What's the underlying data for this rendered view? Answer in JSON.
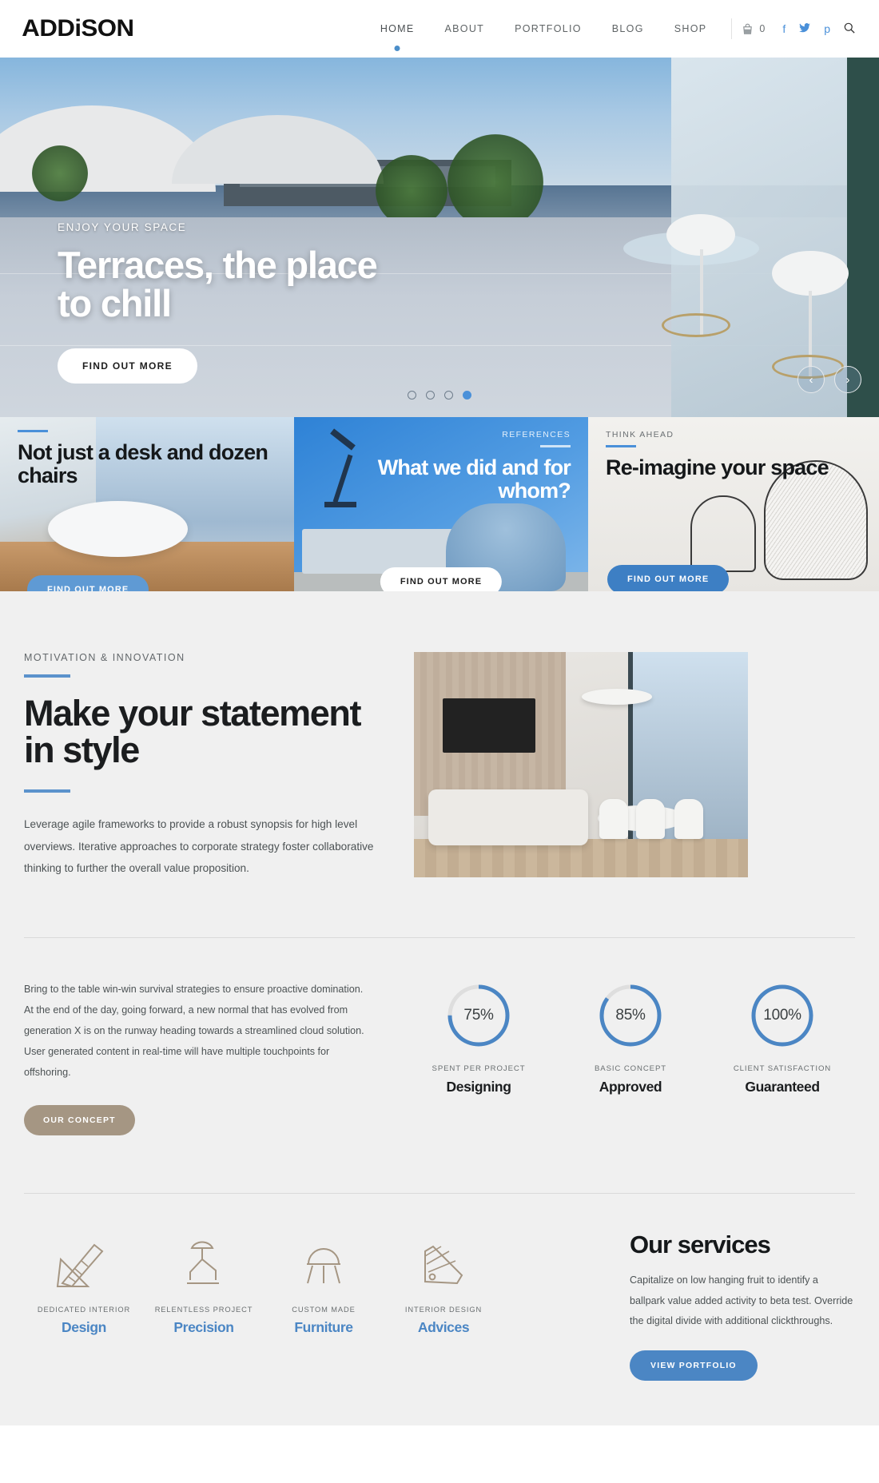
{
  "header": {
    "logo": "ADDiSON",
    "nav": [
      {
        "label": "HOME",
        "active": true
      },
      {
        "label": "ABOUT",
        "active": false
      },
      {
        "label": "PORTFOLIO",
        "active": false
      },
      {
        "label": "BLOG",
        "active": false
      },
      {
        "label": "SHOP",
        "active": false
      }
    ],
    "cart_count": "0",
    "socials": [
      "facebook-icon",
      "twitter-icon",
      "pinterest-icon",
      "search-icon"
    ]
  },
  "hero": {
    "eyebrow": "ENJOY YOUR SPACE",
    "title": "Terraces, the place to chill",
    "button": "FIND OUT MORE",
    "slides_total": 4,
    "active_slide": 4,
    "prev_label": "‹",
    "next_label": "›"
  },
  "promos": [
    {
      "eyebrow": "",
      "title": "Not just a desk and dozen chairs",
      "button": "FIND OUT MORE"
    },
    {
      "eyebrow": "REFERENCES",
      "title": "What we did and for whom?",
      "button": "FIND OUT MORE"
    },
    {
      "eyebrow": "THINK AHEAD",
      "title": "Re-imagine your space",
      "button": "FIND OUT MORE"
    }
  ],
  "statement": {
    "eyebrow": "MOTIVATION & INNOVATION",
    "title": "Make your statement in style",
    "body": "Leverage agile frameworks to provide a robust synopsis for high level overviews. Iterative approaches to corporate strategy foster collaborative thinking to further the overall value proposition."
  },
  "stats": {
    "body": "Bring to the table win-win survival strategies to ensure proactive domination. At the end of the day, going forward, a new normal that has evolved from generation X is on the runway heading towards a streamlined cloud solution. User generated content in real-time will have multiple touchpoints for offshoring.",
    "button": "OUR CONCEPT",
    "items": [
      {
        "pct": "75%",
        "value": 75,
        "sub": "SPENT PER PROJECT",
        "name": "Designing"
      },
      {
        "pct": "85%",
        "value": 85,
        "sub": "BASIC CONCEPT",
        "name": "Approved"
      },
      {
        "pct": "100%",
        "value": 100,
        "sub": "CLIENT SATISFACTION",
        "name": "Guaranteed"
      }
    ]
  },
  "services": {
    "items": [
      {
        "icon": "ruler-triangle-icon",
        "sub": "DEDICATED INTERIOR",
        "name": "Design"
      },
      {
        "icon": "desk-lamp-icon",
        "sub": "RELENTLESS PROJECT",
        "name": "Precision"
      },
      {
        "icon": "stool-chair-icon",
        "sub": "CUSTOM MADE",
        "name": "Furniture"
      },
      {
        "icon": "color-swatch-icon",
        "sub": "INTERIOR DESIGN",
        "name": "Advices"
      }
    ],
    "title": "Our services",
    "text": "Capitalize on low hanging fruit to identify a ballpark value added activity to beta test. Override the digital divide with additional clickthroughs.",
    "button": "VIEW PORTFOLIO"
  },
  "colors": {
    "accent": "#4b86c4",
    "accent_light": "#5f9ad4",
    "tan": "#a59683",
    "dark": "#15181a",
    "bg": "#f0f0f0"
  }
}
